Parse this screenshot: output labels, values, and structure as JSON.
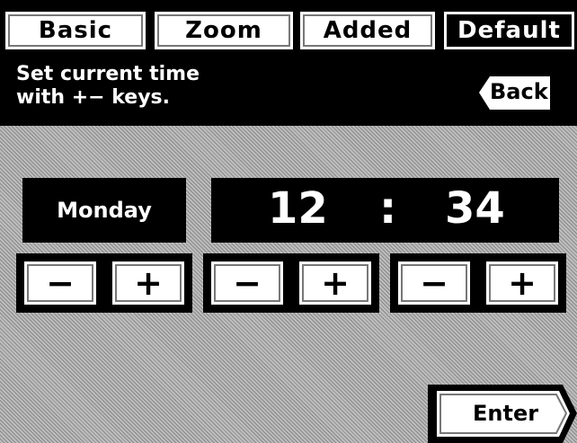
{
  "tabs": [
    {
      "label": "Basic"
    },
    {
      "label": "Zoom"
    },
    {
      "label": "Added"
    },
    {
      "label": "Default"
    }
  ],
  "message": {
    "line1": "Set current time",
    "line2": "with +− keys."
  },
  "back_label": "Back",
  "display": {
    "day": "Monday",
    "hour": "12",
    "separator": ":",
    "minute": "34"
  },
  "steppers": {
    "minus": "−",
    "plus": "+"
  },
  "enter_label": "Enter"
}
